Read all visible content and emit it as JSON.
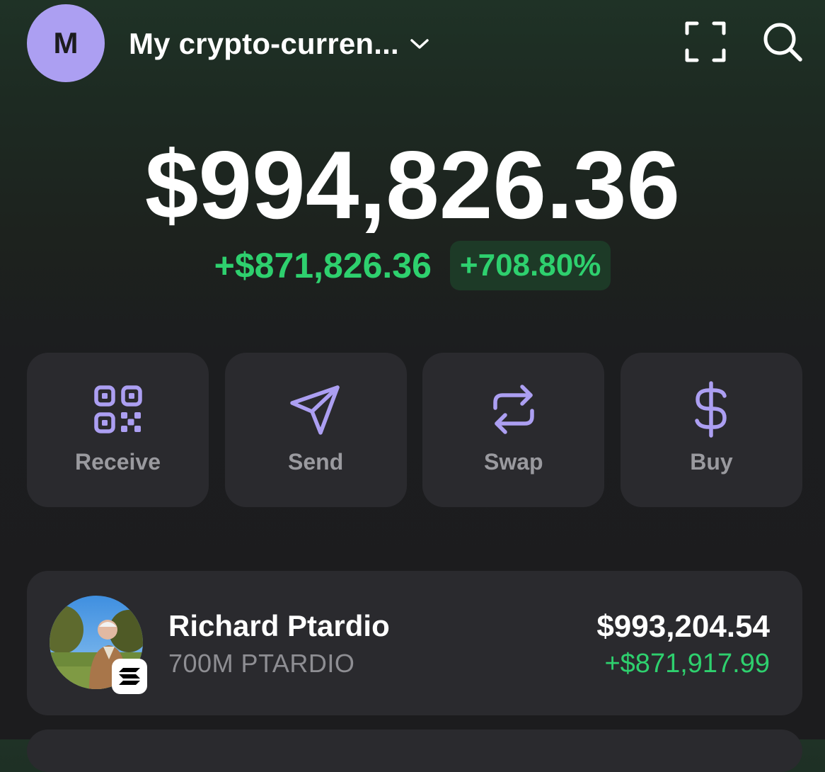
{
  "header": {
    "avatar_initial": "M",
    "wallet_name": "My crypto-curren...",
    "icons": {
      "dropdown": "chevron-down-icon",
      "scan": "scan-icon",
      "search": "search-icon"
    }
  },
  "balance": {
    "total": "$994,826.36",
    "change_amount": "+$871,826.36",
    "change_percent": "+708.80%"
  },
  "actions": [
    {
      "label": "Receive",
      "icon": "qr-code-icon"
    },
    {
      "label": "Send",
      "icon": "send-icon"
    },
    {
      "label": "Swap",
      "icon": "swap-icon"
    },
    {
      "label": "Buy",
      "icon": "dollar-icon"
    }
  ],
  "tokens": [
    {
      "name": "Richard Ptardio",
      "amount": "700M PTARDIO",
      "value": "$993,204.54",
      "change": "+$871,917.99",
      "chain_icon": "solana-icon"
    }
  ],
  "colors": {
    "accent": "#ac9ff2",
    "positive": "#2ed06e",
    "card": "#2a2a2e",
    "background": "#1c1c1e"
  }
}
